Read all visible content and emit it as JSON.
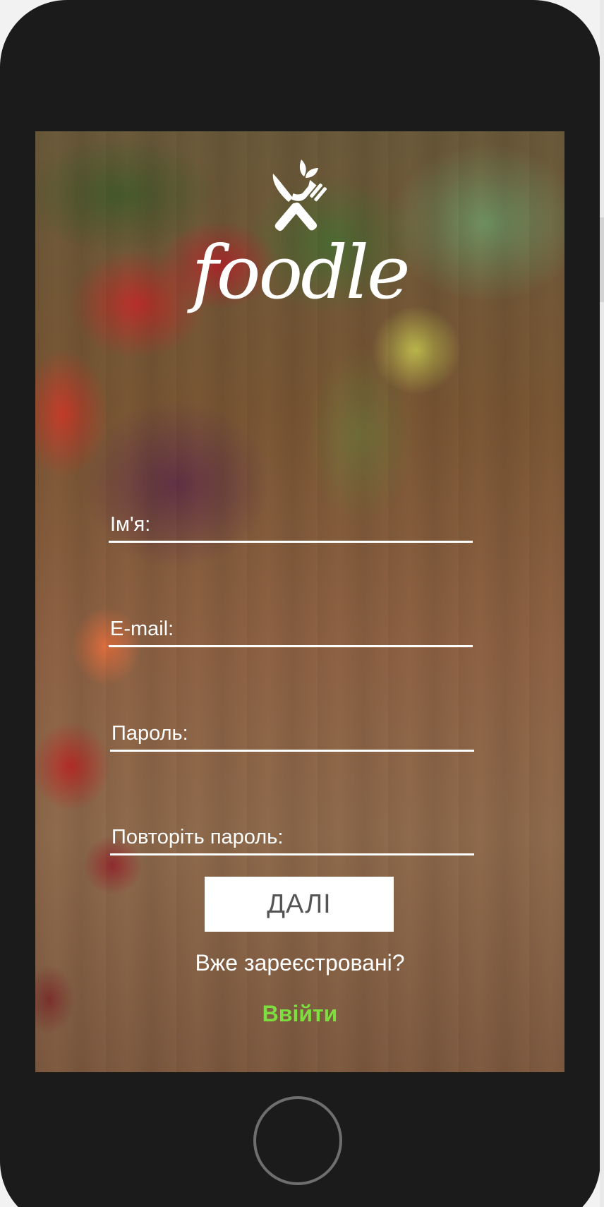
{
  "app": {
    "brand_name": "foodle",
    "logo_icon": "fork-knife-leaf-icon"
  },
  "form": {
    "fields": [
      {
        "label": "Ім'я:",
        "value": ""
      },
      {
        "label": "E-mail:",
        "value": ""
      },
      {
        "label": "Пароль:",
        "value": ""
      },
      {
        "label": "Повторіть пароль:",
        "value": ""
      }
    ]
  },
  "actions": {
    "next_label": "ДАЛІ",
    "already_registered": "Вже зареєстровані?",
    "login_label": "Ввійти"
  },
  "colors": {
    "accent": "#7dde3f",
    "device_body": "#1b1b1b",
    "button_bg": "#ffffff"
  }
}
